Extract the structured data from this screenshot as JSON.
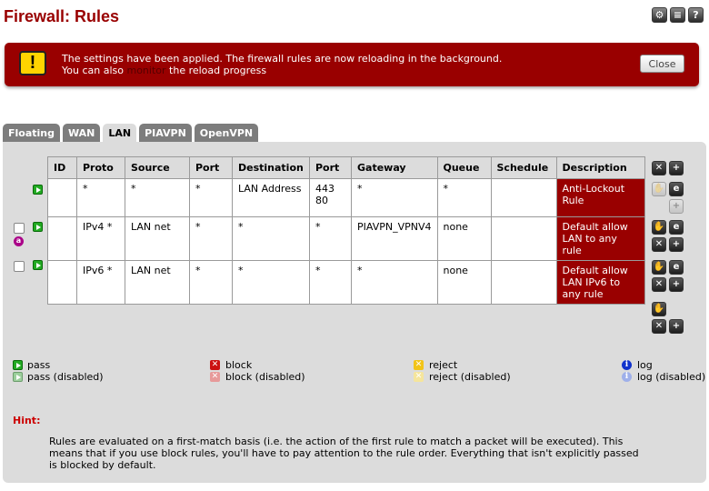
{
  "page": {
    "title": "Firewall: Rules"
  },
  "top_icons": [
    {
      "name": "settings-icon",
      "glyph": "⚙"
    },
    {
      "name": "list-icon",
      "glyph": "≡"
    },
    {
      "name": "help-icon",
      "glyph": "?"
    }
  ],
  "banner": {
    "line1": "The settings have been applied. The firewall rules are now reloading in the background.",
    "line2_prefix": "You can also",
    "line2_link": "monitor",
    "line2_suffix": "the reload progress",
    "close_label": "Close",
    "colors": {
      "background": "#990000",
      "icon": "#ffd400"
    }
  },
  "tabs": [
    {
      "label": "Floating",
      "active": false
    },
    {
      "label": "WAN",
      "active": false
    },
    {
      "label": "LAN",
      "active": true
    },
    {
      "label": "PIAVPN",
      "active": false
    },
    {
      "label": "OpenVPN",
      "active": false
    }
  ],
  "table": {
    "headers": [
      "ID",
      "Proto",
      "Source",
      "Port",
      "Destination",
      "Port",
      "Gateway",
      "Queue",
      "Schedule",
      "Description"
    ],
    "rows": [
      {
        "id": "",
        "proto": "*",
        "source": "*",
        "src_port": "*",
        "destination": "LAN Address",
        "dst_port_line1": "443",
        "dst_port_line2": "80",
        "gateway": "*",
        "queue": "*",
        "schedule": "",
        "description": "Anti-Lockout Rule",
        "has_checkbox": false,
        "action": "pass"
      },
      {
        "id": "",
        "proto": "IPv4 *",
        "source": "LAN net",
        "src_port": "*",
        "destination": "*",
        "dst_port_line1": "*",
        "dst_port_line2": "",
        "gateway": "PIAVPN_VPNV4",
        "queue": "none",
        "schedule": "",
        "description": "Default allow LAN to any rule",
        "has_checkbox": true,
        "action": "pass",
        "advanced_badge": "a"
      },
      {
        "id": "",
        "proto": "IPv6 *",
        "source": "LAN net",
        "src_port": "*",
        "destination": "*",
        "dst_port_line1": "*",
        "dst_port_line2": "",
        "gateway": "*",
        "queue": "none",
        "schedule": "",
        "description": "Default allow LAN IPv6 to any rule",
        "has_checkbox": true,
        "action": "pass"
      }
    ],
    "colors": {
      "description_bg": "#990000"
    }
  },
  "legend": {
    "pass": "pass",
    "pass_disabled": "pass (disabled)",
    "block": "block",
    "block_disabled": "block (disabled)",
    "reject": "reject",
    "reject_disabled": "reject (disabled)",
    "log": "log",
    "log_disabled": "log (disabled)"
  },
  "hint": {
    "title": "Hint:",
    "text": "Rules are evaluated on a first-match basis (i.e. the action of the first rule to match a packet will be executed). This means that if you use block rules, you'll have to pay attention to the rule order. Everything that isn't explicitly passed is blocked by default."
  }
}
